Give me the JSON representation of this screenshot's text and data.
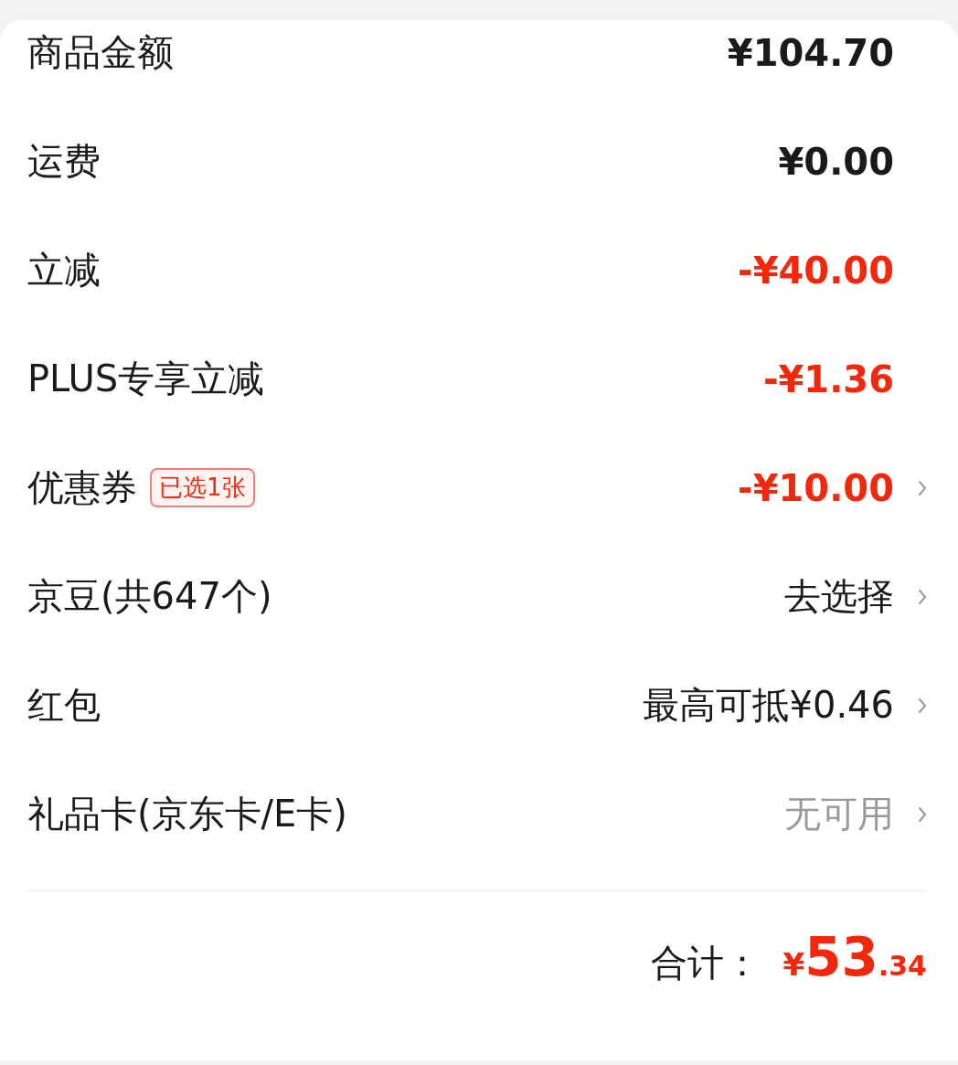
{
  "rows": [
    {
      "label": "商品金额",
      "value": "¥104.70",
      "kind": "amount",
      "arrow": false
    },
    {
      "label": "运费",
      "value": "¥0.00",
      "kind": "amount",
      "arrow": false
    },
    {
      "label": "立减",
      "value": "-¥40.00",
      "kind": "discount",
      "arrow": false
    },
    {
      "label": "PLUS专享立减",
      "value": "-¥1.36",
      "kind": "discount",
      "arrow": false
    },
    {
      "label": "优惠券",
      "badge": "已选1张",
      "value": "-¥10.00",
      "kind": "discount",
      "arrow": true
    },
    {
      "label": "京豆(共647个)",
      "value": "去选择",
      "kind": "action",
      "arrow": true
    },
    {
      "label": "红包",
      "value": "最高可抵¥0.46",
      "kind": "action",
      "arrow": true
    },
    {
      "label": "礼品卡(京东卡/E卡)",
      "value": "无可用",
      "kind": "muted",
      "arrow": true
    }
  ],
  "total": {
    "label": "合计：",
    "currency": "¥",
    "integer": "53",
    "decimal": ".34"
  }
}
